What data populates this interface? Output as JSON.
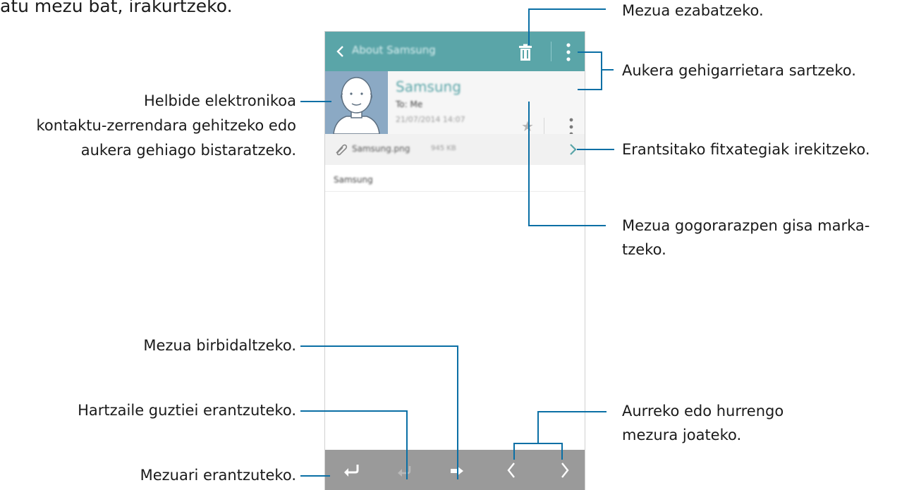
{
  "page": {
    "top_caption": "atu mezu bat, irakurtzeko."
  },
  "app": {
    "appbar": {
      "title": "About Samsung",
      "accent": "#5aa5a8"
    },
    "message": {
      "sender": "Samsung",
      "recipient": "To: Me",
      "date": "21/07/2014 14:07",
      "attachment_name": "Samsung.png",
      "attachment_size": "945 KB",
      "body": "Samsung"
    }
  },
  "icons": {
    "back": "chevron-left-icon",
    "delete": "trash-icon",
    "more": "more-vert-icon",
    "star": "star-icon",
    "expand": "chevron-down-icon",
    "attachment": "paperclip-icon",
    "open": "chevron-right-icon",
    "reply": "reply-icon",
    "reply_all": "reply-all-icon",
    "forward": "forward-icon",
    "previous": "chevron-left-icon",
    "next": "chevron-right-icon"
  },
  "annotations": {
    "delete": "Mezua ezabatzeko.",
    "more_options": "Aukera gehigarrietara sartzeko.",
    "open_attachment": "Erantsitako fitxategiak irekitzeko.",
    "mark_reminder_l1": "Mezua gogorarazpen gisa marka-",
    "mark_reminder_l2": "tzeko.",
    "contact_l1": "Helbide elektronikoa",
    "contact_l2": "kontaktu-zerrendara gehitzeko edo",
    "contact_l3": "aukera gehiago bistaratzeko.",
    "forward": "Mezua birbidaltzeko.",
    "reply_all": "Hartzaile guztiei erantzuteko.",
    "reply": "Mezuari erantzuteko.",
    "prev_next_l1": "Aurreko edo hurrengo",
    "prev_next_l2": "mezura joateko."
  },
  "colors": {
    "callout_line": "#0a6fa5",
    "appbar": "#5aa5a8",
    "bottom_bar": "#9a9a9a"
  }
}
